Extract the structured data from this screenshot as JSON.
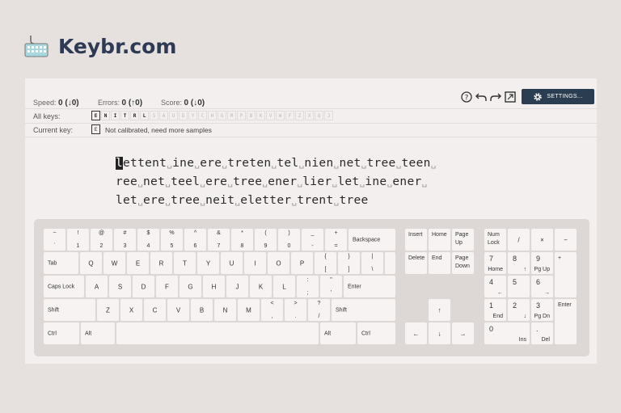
{
  "brand": {
    "title": "Keybr.com"
  },
  "stats": {
    "speed_label": "Speed:",
    "speed_value": "0 (↓0)",
    "errors_label": "Errors:",
    "errors_value": "0 (↑0)",
    "score_label": "Score:",
    "score_value": "0 (↓0)"
  },
  "toolbar": {
    "icons": [
      "help-icon",
      "undo-icon",
      "redo-icon",
      "fullscreen-icon",
      "gear-icon"
    ],
    "settings_label": "SETTINGS..."
  },
  "all_keys": {
    "label": "All keys:",
    "keys": [
      "E",
      "N",
      "I",
      "T",
      "R",
      "L",
      "S",
      "A",
      "U",
      "D",
      "Y",
      "C",
      "H",
      "G",
      "M",
      "P",
      "B",
      "K",
      "V",
      "W",
      "F",
      "Z",
      "X",
      "Q",
      "J"
    ],
    "learned": 6
  },
  "current_key": {
    "label": "Current key:",
    "key": "E",
    "note": "Not calibrated, need more samples"
  },
  "lesson": {
    "lines": [
      [
        "lettent",
        "ine",
        "ere",
        "treten",
        "tel",
        "nien",
        "net",
        "tree",
        "teen"
      ],
      [
        "ree",
        "net",
        "teel",
        "ere",
        "tree",
        "ener",
        "lier",
        "let",
        "ine",
        "ener"
      ],
      [
        "let",
        "ere",
        "tree",
        "neit",
        "eletter",
        "trent",
        "tree"
      ]
    ],
    "space_glyph": "␣"
  },
  "keyboard": {
    "row1": [
      [
        "~",
        "`"
      ],
      [
        "!",
        "1"
      ],
      [
        "@",
        "2"
      ],
      [
        "#",
        "3"
      ],
      [
        "$",
        "4"
      ],
      [
        "%",
        "5"
      ],
      [
        "^",
        "6"
      ],
      [
        "&",
        "7"
      ],
      [
        "*",
        "8"
      ],
      [
        "(",
        "9"
      ],
      [
        ")",
        "0"
      ],
      [
        "_",
        "-"
      ],
      [
        "+",
        "="
      ]
    ],
    "backspace": "Backspace",
    "tab": "Tab",
    "row2": [
      "Q",
      "W",
      "E",
      "R",
      "T",
      "Y",
      "U",
      "I",
      "O",
      "P"
    ],
    "row2_sym": [
      [
        "{",
        "["
      ],
      [
        "}",
        "]"
      ],
      [
        "|",
        "\\"
      ]
    ],
    "caps": "Caps Lock",
    "row3": [
      "A",
      "S",
      "D",
      "F",
      "G",
      "H",
      "J",
      "K",
      "L"
    ],
    "row3_sym": [
      [
        ":",
        ";"
      ],
      [
        "\"",
        "'"
      ]
    ],
    "enter": "Enter",
    "shift": "Shift",
    "row4": [
      "Z",
      "X",
      "C",
      "V",
      "B",
      "N",
      "M"
    ],
    "row4_sym": [
      [
        "<",
        ","
      ],
      [
        ">",
        "."
      ],
      [
        "?",
        "/"
      ]
    ],
    "ctrl": "Ctrl",
    "alt": "Alt",
    "nav": {
      "insert": "Insert",
      "home": "Home",
      "page_up": "Page Up",
      "delete": "Delete",
      "end": "End",
      "page_down": "Page Down"
    },
    "arrows": {
      "up": "↑",
      "left": "←",
      "down": "↓",
      "right": "→"
    },
    "numpad": {
      "numlock": "Num Lock",
      "div": "/",
      "mul": "×",
      "minus": "−",
      "plus": "+",
      "enter": "Enter",
      "n7": [
        "7",
        "Home"
      ],
      "n8": [
        "8",
        "↑"
      ],
      "n9": [
        "9",
        "Pg Up"
      ],
      "n4": [
        "4",
        "←"
      ],
      "n5": [
        "5",
        ""
      ],
      "n6": [
        "6",
        "→"
      ],
      "n1": [
        "1",
        "End"
      ],
      "n2": [
        "2",
        "↓"
      ],
      "n3": [
        "3",
        "Pg Dn"
      ],
      "n0": [
        "0",
        "Ins"
      ],
      "dot": [
        ".",
        "Del"
      ]
    }
  }
}
